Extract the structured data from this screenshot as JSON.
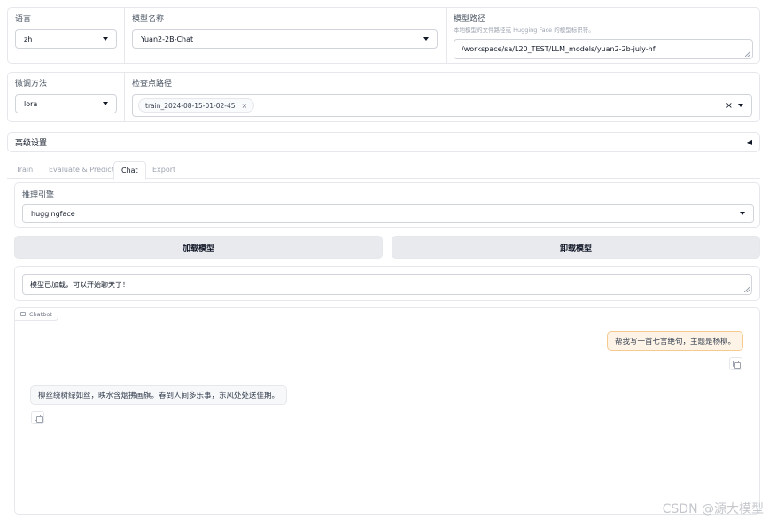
{
  "row1": {
    "language": {
      "label": "语言",
      "value": "zh"
    },
    "model_name": {
      "label": "模型名称",
      "value": "Yuan2-2B-Chat"
    },
    "model_path": {
      "label": "模型路径",
      "hint": "本地模型的文件路径或 Hugging Face 的模型标识符。",
      "value": "/workspace/sa/L20_TEST/LLM_models/yuan2-2b-july-hf"
    }
  },
  "row2": {
    "finetune": {
      "label": "微调方法",
      "value": "lora"
    },
    "checkpoint": {
      "label": "检查点路径",
      "chip": "train_2024-08-15-01-02-45",
      "chip_remove": "×",
      "clear": "×"
    }
  },
  "advanced": {
    "label": "高级设置",
    "toggle": "◀"
  },
  "tabs": [
    {
      "label": "Train"
    },
    {
      "label": "Evaluate & Predict"
    },
    {
      "label": "Chat"
    },
    {
      "label": "Export"
    }
  ],
  "chat": {
    "engine": {
      "label": "推理引擎",
      "value": "huggingface"
    },
    "load_button": "加载模型",
    "unload_button": "卸载模型",
    "status": "模型已加载，可以开始聊天了！",
    "chatbot_label": "Chatbot",
    "messages": [
      {
        "role": "user",
        "text": "帮我写一首七言绝句，主题是杨柳。"
      },
      {
        "role": "assistant",
        "text": "柳丝绕树绿如丝，映水含烟拂画旗。春到人间多乐事，东风处处送佳期。"
      }
    ]
  },
  "watermark": "CSDN @源大模型",
  "colors": {
    "user_bubble_bg": "#fdf4e7",
    "user_bubble_border": "#f6c98f",
    "bot_bubble_bg": "#f7f8fa"
  }
}
